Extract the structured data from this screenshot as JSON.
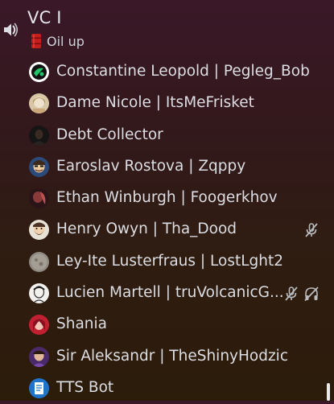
{
  "channel": {
    "name": "VC I",
    "status_text": "Oil up",
    "status_icon": "oil-barrel-icon",
    "channel_icon": "speaker-icon"
  },
  "members": [
    {
      "name": "Constantine Leopold | Pegleg_Bob",
      "avatar": "green-black-avatar",
      "muted": false,
      "deafened": false
    },
    {
      "name": "Dame Nicole | ItsMeFrisket",
      "avatar": "portrait-lady-avatar",
      "muted": false,
      "deafened": false
    },
    {
      "name": "Debt Collector",
      "avatar": "dark-figure-avatar",
      "muted": false,
      "deafened": false
    },
    {
      "name": "Earoslav Rostova | Zqppy",
      "avatar": "cartoon-man-avatar",
      "muted": false,
      "deafened": false
    },
    {
      "name": "Ethan Winburgh | Foogerkhov",
      "avatar": "red-dark-avatar",
      "muted": false,
      "deafened": false
    },
    {
      "name": "Henry Owyn | Tha_Dood",
      "avatar": "bearded-man-avatar",
      "muted": true,
      "deafened": false
    },
    {
      "name": "Ley-Ite Lusterfraus | LostLght2",
      "avatar": "grey-stone-avatar",
      "muted": false,
      "deafened": false
    },
    {
      "name": "Lucien Martell | truVolcanicG...",
      "avatar": "sketch-portrait-avatar",
      "muted": true,
      "deafened": true
    },
    {
      "name": "Shania",
      "avatar": "red-character-avatar",
      "muted": false,
      "deafened": false
    },
    {
      "name": "Sir Aleksandr | TheShinyHodzic",
      "avatar": "purple-character-avatar",
      "muted": false,
      "deafened": false
    },
    {
      "name": "TTS Bot",
      "avatar": "blue-document-avatar",
      "muted": false,
      "deafened": false
    }
  ]
}
